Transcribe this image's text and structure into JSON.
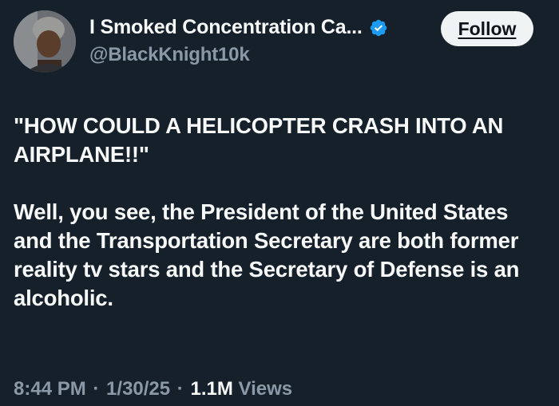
{
  "author": {
    "display_name": "I Smoked Concentration Ca...",
    "handle": "@BlackKnight10k",
    "verified": true,
    "avatar_icon": "person-avatar-icon"
  },
  "actions": {
    "follow_label": "Follow"
  },
  "tweet": {
    "paragraphs": [
      "\"HOW COULD A HELICOPTER CRASH INTO AN AIRPLANE!!\"",
      "Well, you see, the President of the United States and the Transportation Secretary are both former reality tv stars and the Secretary of Defense is an alcoholic."
    ]
  },
  "meta": {
    "time": "8:44 PM",
    "date": "1/30/25",
    "views_count": "1.1M",
    "views_label": "Views",
    "separator": "·"
  },
  "colors": {
    "background": "#15202b",
    "text_primary": "#f7f9f9",
    "text_secondary": "#8b98a5",
    "verified_blue": "#1d9bf0",
    "button_bg": "#eff3f4"
  }
}
